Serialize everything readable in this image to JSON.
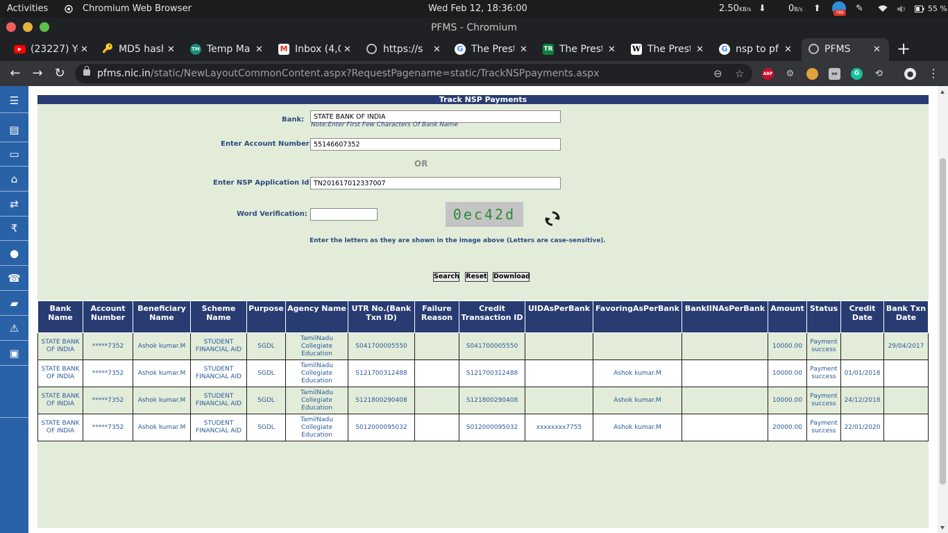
{
  "system_bar": {
    "activities": "Activities",
    "app_name": "Chromium Web Browser",
    "datetime": "Wed Feb 12, 18:36:00",
    "net_down": "2.50",
    "net_down_unit": "KB/s",
    "net_up": "0",
    "net_up_unit": "B/s",
    "recorder_badge": "789",
    "battery": "55 %"
  },
  "window": {
    "title": "PFMS - Chromium"
  },
  "tabs": [
    {
      "label": "(23227) Yo",
      "favicon": "youtube-icon",
      "color": "#ff0000"
    },
    {
      "label": "MD5 hash",
      "favicon": "key-icon",
      "color": "#e8b300"
    },
    {
      "label": "Temp Ma",
      "favicon": "temp-mail-icon",
      "color": "#1d8a7a"
    },
    {
      "label": "Inbox (4,0",
      "favicon": "gmail-icon",
      "color": "#d93025"
    },
    {
      "label": "https://s",
      "favicon": "globe-icon",
      "color": "#bdc1c6"
    },
    {
      "label": "The Prest",
      "favicon": "google-icon",
      "color": "#4285f4"
    },
    {
      "label": "The Prest",
      "favicon": "tr-icon",
      "color": "#0b8043"
    },
    {
      "label": "The Prest",
      "favicon": "wikipedia-icon",
      "color": "#ffffff"
    },
    {
      "label": "nsp to pf",
      "favicon": "google-icon",
      "color": "#4285f4"
    },
    {
      "label": "PFMS",
      "favicon": "globe-icon",
      "color": "#bdc1c6"
    }
  ],
  "address_bar": {
    "host": "pfms.nic.in",
    "path": "/static/NewLayoutCommonContent.aspx?RequestPagename=static/TrackNSPpayments.aspx"
  },
  "extensions": [
    {
      "name": "adblock-plus-icon",
      "text": "ABP",
      "color": "#c70d2c"
    },
    {
      "name": "bike-extension-icon",
      "text": "",
      "color": "#9aa0a6"
    },
    {
      "name": "cookie-icon",
      "text": "",
      "color": "#e0a23b"
    },
    {
      "name": "glasses-extension-icon",
      "text": "",
      "color": "#9aa0a6"
    },
    {
      "name": "grammarly-icon",
      "text": "G",
      "color": "#15c39a"
    },
    {
      "name": "sync-extension-icon",
      "text": "",
      "color": "#9aa0a6"
    }
  ],
  "sidebar": {
    "items": [
      {
        "name": "menu-icon",
        "glyph": "☰"
      },
      {
        "name": "building-icon",
        "glyph": "▤"
      },
      {
        "name": "card-icon",
        "glyph": "▭"
      },
      {
        "name": "bank-icon",
        "glyph": "⌂"
      },
      {
        "name": "transfer-icon",
        "glyph": "⇄"
      },
      {
        "name": "rupee-icon",
        "glyph": "₹"
      },
      {
        "name": "map-marker-icon",
        "glyph": "●"
      },
      {
        "name": "phone-icon",
        "glyph": "☎"
      },
      {
        "name": "comment-icon",
        "glyph": "▰"
      },
      {
        "name": "warning-icon",
        "glyph": "⚠"
      },
      {
        "name": "briefcase-icon",
        "glyph": "▣"
      },
      {
        "name": "blank-item",
        "glyph": ""
      }
    ]
  },
  "form": {
    "heading": "Track NSP Payments",
    "bank_label": "Bank:",
    "bank_value": "STATE BANK OF INDIA",
    "bank_note": "Note:Enter First Few Characters Of Bank Name",
    "account_label": "Enter Account Number:",
    "account_value": "55146607352",
    "or_text": "OR",
    "app_id_label": "Enter NSP Application Id:",
    "app_id_value": "TN201617012337007",
    "verification_label": "Word Verification:",
    "verification_value": "",
    "captcha_text": "0ec42d",
    "hint": "Enter the letters as they are shown in the image above (Letters are case-sensitive).",
    "search_button": "Search",
    "reset_button": "Reset",
    "download_button": "Download"
  },
  "table": {
    "headers": [
      "Bank Name",
      "Account Number",
      "Beneficiary Name",
      "Scheme Name",
      "Purpose",
      "Agency Name",
      "UTR No.(Bank Txn ID)",
      "Failure Reason",
      "Credit Transaction ID",
      "UIDAsPerBank",
      "FavoringAsPerBank",
      "BankIINAsPerBank",
      "Amount",
      "Status",
      "Credit Date",
      "Bank Txn Date"
    ],
    "rows": [
      [
        "STATE BANK OF INDIA",
        "*****7352",
        "Ashok kumar.M",
        "STUDENT FINANCIAL AID",
        "SGDL",
        "TamilNadu Collegiate Education",
        "S041700005550",
        "",
        "S041700005550",
        "",
        "",
        "",
        "10000.00",
        "Payment success",
        "",
        "29/04/2017"
      ],
      [
        "STATE BANK OF INDIA",
        "*****7352",
        "Ashok kumar.M",
        "STUDENT FINANCIAL AID",
        "SGDL",
        "TamilNadu Collegiate Education",
        "S121700312488",
        "",
        "S121700312488",
        "",
        "Ashok kumar.M",
        "",
        "10000.00",
        "Payment success",
        "01/01/2018",
        ""
      ],
      [
        "STATE BANK OF INDIA",
        "*****7352",
        "Ashok kumar.M",
        "STUDENT FINANCIAL AID",
        "SGDL",
        "TamilNadu Collegiate Education",
        "S121800290408",
        "",
        "S121800290408",
        "",
        "Ashok kumar.M",
        "",
        "10000.00",
        "Payment success",
        "24/12/2018",
        ""
      ],
      [
        "STATE BANK OF INDIA",
        "*****7352",
        "Ashok kumar.M",
        "STUDENT FINANCIAL AID",
        "SGDL",
        "TamilNadu Collegiate Education",
        "S012000095032",
        "",
        "S012000095032",
        "xxxxxxxx7755",
        "Ashok kumar.M",
        "",
        "20000.00",
        "Payment success",
        "22/01/2020",
        ""
      ]
    ]
  }
}
